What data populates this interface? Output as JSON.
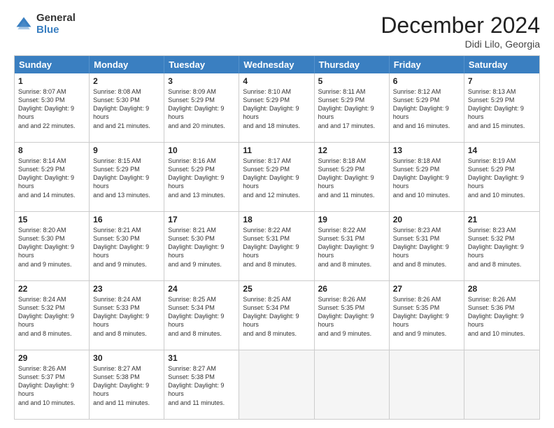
{
  "logo": {
    "general": "General",
    "blue": "Blue"
  },
  "header": {
    "month": "December 2024",
    "location": "Didi Lilo, Georgia"
  },
  "days": [
    "Sunday",
    "Monday",
    "Tuesday",
    "Wednesday",
    "Thursday",
    "Friday",
    "Saturday"
  ],
  "weeks": [
    [
      {
        "day": "1",
        "sunrise": "Sunrise: 8:07 AM",
        "sunset": "Sunset: 5:30 PM",
        "daylight": "Daylight: 9 hours and 22 minutes."
      },
      {
        "day": "2",
        "sunrise": "Sunrise: 8:08 AM",
        "sunset": "Sunset: 5:30 PM",
        "daylight": "Daylight: 9 hours and 21 minutes."
      },
      {
        "day": "3",
        "sunrise": "Sunrise: 8:09 AM",
        "sunset": "Sunset: 5:29 PM",
        "daylight": "Daylight: 9 hours and 20 minutes."
      },
      {
        "day": "4",
        "sunrise": "Sunrise: 8:10 AM",
        "sunset": "Sunset: 5:29 PM",
        "daylight": "Daylight: 9 hours and 18 minutes."
      },
      {
        "day": "5",
        "sunrise": "Sunrise: 8:11 AM",
        "sunset": "Sunset: 5:29 PM",
        "daylight": "Daylight: 9 hours and 17 minutes."
      },
      {
        "day": "6",
        "sunrise": "Sunrise: 8:12 AM",
        "sunset": "Sunset: 5:29 PM",
        "daylight": "Daylight: 9 hours and 16 minutes."
      },
      {
        "day": "7",
        "sunrise": "Sunrise: 8:13 AM",
        "sunset": "Sunset: 5:29 PM",
        "daylight": "Daylight: 9 hours and 15 minutes."
      }
    ],
    [
      {
        "day": "8",
        "sunrise": "Sunrise: 8:14 AM",
        "sunset": "Sunset: 5:29 PM",
        "daylight": "Daylight: 9 hours and 14 minutes."
      },
      {
        "day": "9",
        "sunrise": "Sunrise: 8:15 AM",
        "sunset": "Sunset: 5:29 PM",
        "daylight": "Daylight: 9 hours and 13 minutes."
      },
      {
        "day": "10",
        "sunrise": "Sunrise: 8:16 AM",
        "sunset": "Sunset: 5:29 PM",
        "daylight": "Daylight: 9 hours and 13 minutes."
      },
      {
        "day": "11",
        "sunrise": "Sunrise: 8:17 AM",
        "sunset": "Sunset: 5:29 PM",
        "daylight": "Daylight: 9 hours and 12 minutes."
      },
      {
        "day": "12",
        "sunrise": "Sunrise: 8:18 AM",
        "sunset": "Sunset: 5:29 PM",
        "daylight": "Daylight: 9 hours and 11 minutes."
      },
      {
        "day": "13",
        "sunrise": "Sunrise: 8:18 AM",
        "sunset": "Sunset: 5:29 PM",
        "daylight": "Daylight: 9 hours and 10 minutes."
      },
      {
        "day": "14",
        "sunrise": "Sunrise: 8:19 AM",
        "sunset": "Sunset: 5:29 PM",
        "daylight": "Daylight: 9 hours and 10 minutes."
      }
    ],
    [
      {
        "day": "15",
        "sunrise": "Sunrise: 8:20 AM",
        "sunset": "Sunset: 5:30 PM",
        "daylight": "Daylight: 9 hours and 9 minutes."
      },
      {
        "day": "16",
        "sunrise": "Sunrise: 8:21 AM",
        "sunset": "Sunset: 5:30 PM",
        "daylight": "Daylight: 9 hours and 9 minutes."
      },
      {
        "day": "17",
        "sunrise": "Sunrise: 8:21 AM",
        "sunset": "Sunset: 5:30 PM",
        "daylight": "Daylight: 9 hours and 9 minutes."
      },
      {
        "day": "18",
        "sunrise": "Sunrise: 8:22 AM",
        "sunset": "Sunset: 5:31 PM",
        "daylight": "Daylight: 9 hours and 8 minutes."
      },
      {
        "day": "19",
        "sunrise": "Sunrise: 8:22 AM",
        "sunset": "Sunset: 5:31 PM",
        "daylight": "Daylight: 9 hours and 8 minutes."
      },
      {
        "day": "20",
        "sunrise": "Sunrise: 8:23 AM",
        "sunset": "Sunset: 5:31 PM",
        "daylight": "Daylight: 9 hours and 8 minutes."
      },
      {
        "day": "21",
        "sunrise": "Sunrise: 8:23 AM",
        "sunset": "Sunset: 5:32 PM",
        "daylight": "Daylight: 9 hours and 8 minutes."
      }
    ],
    [
      {
        "day": "22",
        "sunrise": "Sunrise: 8:24 AM",
        "sunset": "Sunset: 5:32 PM",
        "daylight": "Daylight: 9 hours and 8 minutes."
      },
      {
        "day": "23",
        "sunrise": "Sunrise: 8:24 AM",
        "sunset": "Sunset: 5:33 PM",
        "daylight": "Daylight: 9 hours and 8 minutes."
      },
      {
        "day": "24",
        "sunrise": "Sunrise: 8:25 AM",
        "sunset": "Sunset: 5:34 PM",
        "daylight": "Daylight: 9 hours and 8 minutes."
      },
      {
        "day": "25",
        "sunrise": "Sunrise: 8:25 AM",
        "sunset": "Sunset: 5:34 PM",
        "daylight": "Daylight: 9 hours and 8 minutes."
      },
      {
        "day": "26",
        "sunrise": "Sunrise: 8:26 AM",
        "sunset": "Sunset: 5:35 PM",
        "daylight": "Daylight: 9 hours and 9 minutes."
      },
      {
        "day": "27",
        "sunrise": "Sunrise: 8:26 AM",
        "sunset": "Sunset: 5:35 PM",
        "daylight": "Daylight: 9 hours and 9 minutes."
      },
      {
        "day": "28",
        "sunrise": "Sunrise: 8:26 AM",
        "sunset": "Sunset: 5:36 PM",
        "daylight": "Daylight: 9 hours and 10 minutes."
      }
    ],
    [
      {
        "day": "29",
        "sunrise": "Sunrise: 8:26 AM",
        "sunset": "Sunset: 5:37 PM",
        "daylight": "Daylight: 9 hours and 10 minutes."
      },
      {
        "day": "30",
        "sunrise": "Sunrise: 8:27 AM",
        "sunset": "Sunset: 5:38 PM",
        "daylight": "Daylight: 9 hours and 11 minutes."
      },
      {
        "day": "31",
        "sunrise": "Sunrise: 8:27 AM",
        "sunset": "Sunset: 5:38 PM",
        "daylight": "Daylight: 9 hours and 11 minutes."
      },
      null,
      null,
      null,
      null
    ]
  ]
}
